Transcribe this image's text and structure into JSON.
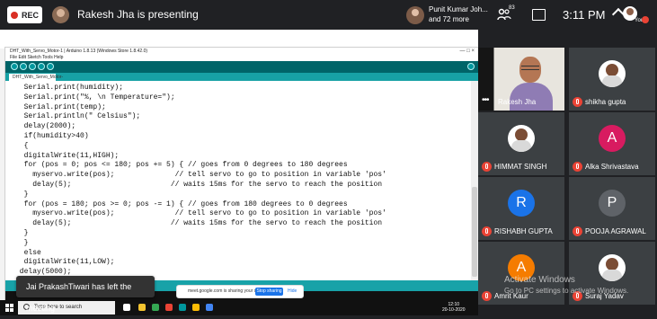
{
  "topbar": {
    "rec_label": "REC",
    "presenter": "Rakesh Jha is presenting",
    "participant_line1": "Punit Kumar Joh...",
    "participant_line2": "and 72 more",
    "people_count": "83",
    "time": "3:11 PM",
    "you_label": "You"
  },
  "arduino": {
    "title": "DHT_With_Servo_Motor-1 | Arduino 1.8.13 (Windows Store 1.8.42.0)",
    "menu": "File Edit Sketch Tools Help",
    "tab": "DHT_With_Servo_Motor-1",
    "window_controls": "— □ ×",
    "code_lines": [
      "  Serial.print(humidity);",
      "  Serial.print(\"%, \\n Temperature=\");",
      "  Serial.print(temp);",
      "  Serial.println(\" Celsius\");",
      "  delay(2000);",
      "  if(humidity>40)",
      "  {",
      "  digitalWrite(11,HIGH);",
      "  for (pos = 0; pos <= 180; pos += 5) { // goes from 0 degrees to 180 degrees",
      "    myservo.write(pos);              // tell servo to go to position in variable 'pos'",
      "    delay(5);                       // waits 15ms for the servo to reach the position",
      "  }",
      "  for (pos = 180; pos >= 0; pos -= 1) { // goes from 180 degrees to 0 degrees",
      "    myservo.write(pos);              // tell servo to go to position in variable 'pos'",
      "    delay(5);                       // waits 15ms for the servo to reach the position",
      "  }",
      "  }",
      "  else",
      "  digitalWrite(11,LOW);",
      " delay(5000);"
    ]
  },
  "taskbar": {
    "search_placeholder": "Type here to search",
    "share_text": "meet.google.com is sharing your screen",
    "stop_sharing": "Stop sharing",
    "hide": "Hide",
    "tray_line1": "12:10",
    "tray_line2": "20-10-2020"
  },
  "notification": {
    "toast": "Jai PrakashTiwari has left the meeting"
  },
  "participants": [
    {
      "name": "Rakesh Jha",
      "type": "video"
    },
    {
      "name": "shikha gupta",
      "type": "photo"
    },
    {
      "name": "HIMMAT SINGH",
      "type": "photo"
    },
    {
      "name": "Alka Shrivastava",
      "letter": "A",
      "color": "#d81b60"
    },
    {
      "name": "RISHABH GUPTA",
      "letter": "R",
      "color": "#1a73e8"
    },
    {
      "name": "POOJA AGRAWAL",
      "letter": "P",
      "color": "#5f6368"
    },
    {
      "name": "Amrit Kaur",
      "letter": "A",
      "color": "#f57c00"
    },
    {
      "name": "Suraj Yadav",
      "type": "photo"
    }
  ],
  "watermark": {
    "line1": "Activate Windows",
    "line2": "Go to PC settings to activate Windows."
  }
}
